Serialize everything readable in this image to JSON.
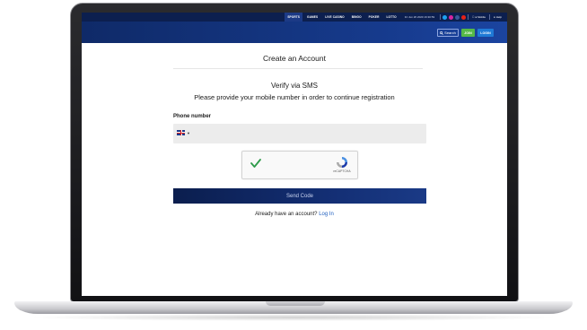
{
  "top_nav": {
    "links": [
      {
        "label": "SPORTS",
        "active": true
      },
      {
        "label": "GAMES",
        "active": false
      },
      {
        "label": "LIVE CASINO",
        "active": false
      },
      {
        "label": "BINGO",
        "active": false
      },
      {
        "label": "POKER",
        "active": false
      },
      {
        "label": "LOTTO",
        "active": false
      }
    ],
    "datetime": "Fri Jun 26 2020 16:30:59",
    "social_icons": [
      "twitter-icon",
      "instagram-icon",
      "facebook-icon",
      "youtube-icon"
    ],
    "mobile_label": "Mobile",
    "help_label": "Help"
  },
  "header": {
    "search_label": "Search",
    "join_label": "JOIN",
    "login_label": "LOGIN"
  },
  "form": {
    "page_title": "Create an Account",
    "verify_title": "Verify via SMS",
    "verify_desc": "Please provide your mobile number in order to continue registration",
    "phone_label": "Phone number",
    "phone_value": "",
    "country_flag": "uk-flag-icon",
    "recaptcha_label": "reCAPTCHA",
    "recaptcha_checked": true,
    "send_label": "Send Code",
    "login_prompt": "Already have an account?",
    "login_link": "Log In"
  },
  "colors": {
    "nav_dark": "#0c1f4f",
    "header_blue": "#163a8c",
    "join_green": "#55b947",
    "login_blue": "#1f7ad6",
    "link_blue": "#1f5fbf",
    "check_green": "#2e9b4a"
  }
}
